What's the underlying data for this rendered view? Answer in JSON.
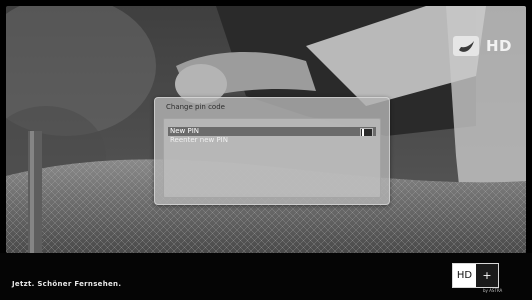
{
  "dialog": {
    "title": "Change pin code",
    "new_pin_label": "New PIN",
    "reenter_pin_label": "Reenter new PIN"
  },
  "brand": {
    "hd_label": "HD",
    "icon": "channel-logo-icon"
  },
  "footer": {
    "slogan": "Jetzt. Schöner Fernsehen.",
    "hdplus_hd": "HD",
    "hdplus_plus": "+",
    "hdplus_sub": "by ASTRA"
  },
  "colors": {
    "background": "#000000",
    "dialog": "#b2b2b2",
    "selected_row": "#6b6b6b",
    "text_light": "#ffffff"
  }
}
